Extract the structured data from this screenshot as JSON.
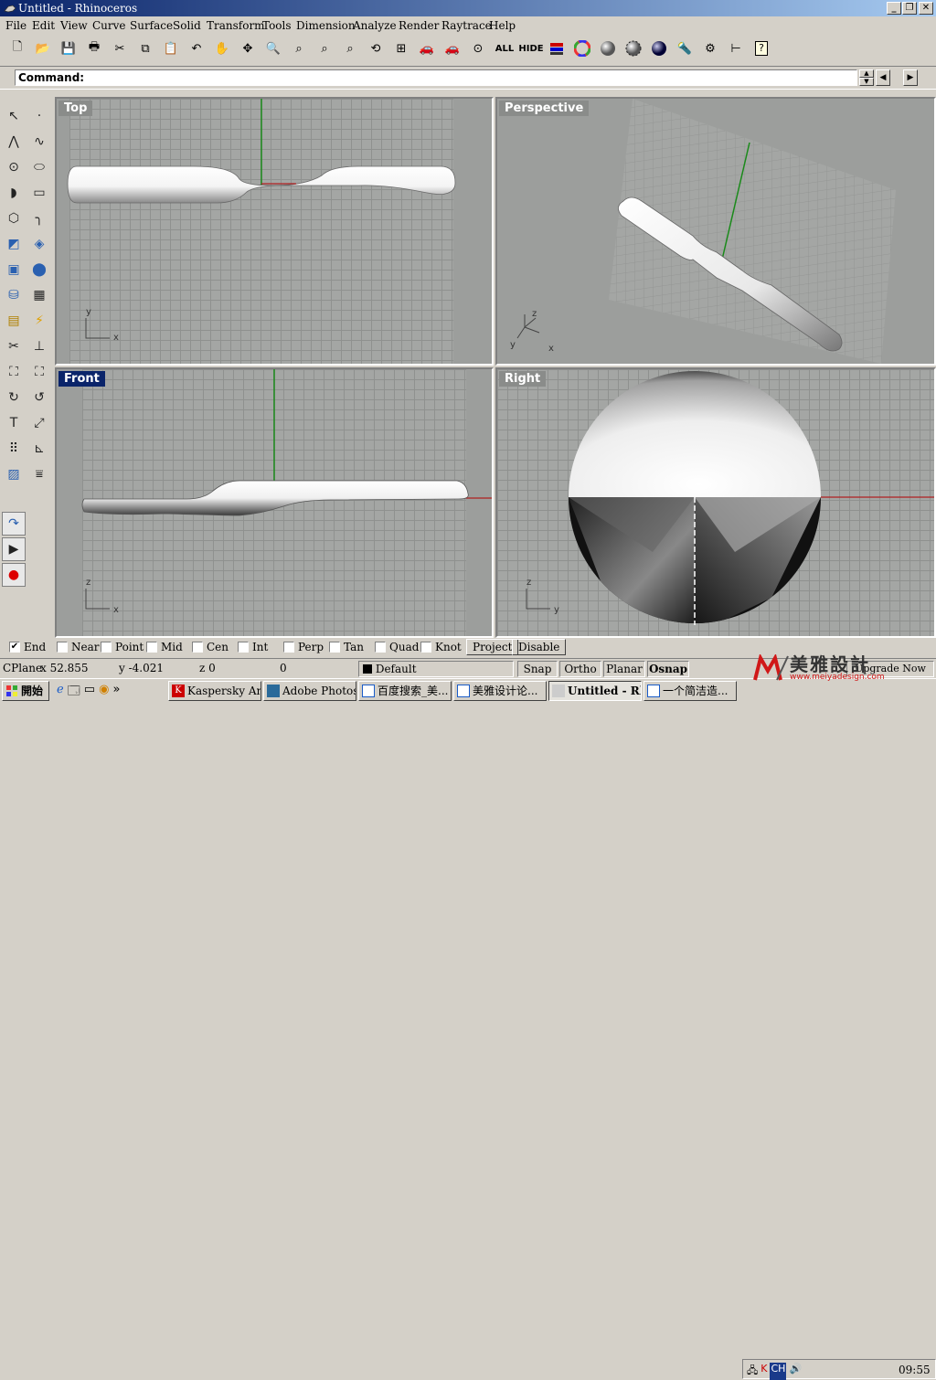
{
  "window": {
    "title": "Untitled - Rhinoceros"
  },
  "menu": [
    "File",
    "Edit",
    "View",
    "Curve",
    "Surface",
    "Solid",
    "Transform",
    "Tools",
    "Dimension",
    "Analyze",
    "Render",
    "Raytrace",
    "Help"
  ],
  "toolbar": {
    "all_label": "ALL",
    "hide_label": "HIDE"
  },
  "command": {
    "label": "Command:"
  },
  "viewports": {
    "top": {
      "label": "Top",
      "axis_y": "y",
      "axis_x": "x"
    },
    "perspective": {
      "label": "Perspective",
      "axis_z": "z",
      "axis_x": "x",
      "axis_y": "y"
    },
    "front": {
      "label": "Front",
      "axis_z": "z",
      "axis_x": "x"
    },
    "right": {
      "label": "Right",
      "axis_z": "z",
      "axis_y": "y"
    }
  },
  "osnap": {
    "items": [
      {
        "label": "End",
        "checked": true
      },
      {
        "label": "Near",
        "checked": false
      },
      {
        "label": "Point",
        "checked": false
      },
      {
        "label": "Mid",
        "checked": false
      },
      {
        "label": "Cen",
        "checked": false
      },
      {
        "label": "Int",
        "checked": false
      },
      {
        "label": "Perp",
        "checked": false
      },
      {
        "label": "Tan",
        "checked": false
      },
      {
        "label": "Quad",
        "checked": false
      },
      {
        "label": "Knot",
        "checked": false
      }
    ],
    "project_label": "Project",
    "disable_label": "Disable"
  },
  "status": {
    "cplane": "CPlane",
    "x": "x 52.855",
    "y": "y -4.021",
    "z": "z 0",
    "extra": "0",
    "layer": "Default",
    "snap": "Snap",
    "ortho": "Ortho",
    "planar": "Planar",
    "osnap": "Osnap",
    "upgrade": "Upgrade Now"
  },
  "taskbar": {
    "start": "開始",
    "items": [
      {
        "label": "Kaspersky An..."
      },
      {
        "label": "Adobe Photos..."
      },
      {
        "label": "百度搜索_美..."
      },
      {
        "label": "美雅设计论..."
      },
      {
        "label": "Untitled - Rhi..."
      },
      {
        "label": "一个简洁造..."
      }
    ],
    "clock": "09:55"
  },
  "watermark": {
    "brand": "美雅設計",
    "url": "www.meiyadesign.com"
  },
  "colors": {
    "title_start": "#0a246a",
    "title_end": "#a6caf0",
    "viewport_bg": "#a4a6a4",
    "grid_line": "#8f918f",
    "axis_green": "#1a8a1a",
    "axis_red": "#b02020"
  }
}
